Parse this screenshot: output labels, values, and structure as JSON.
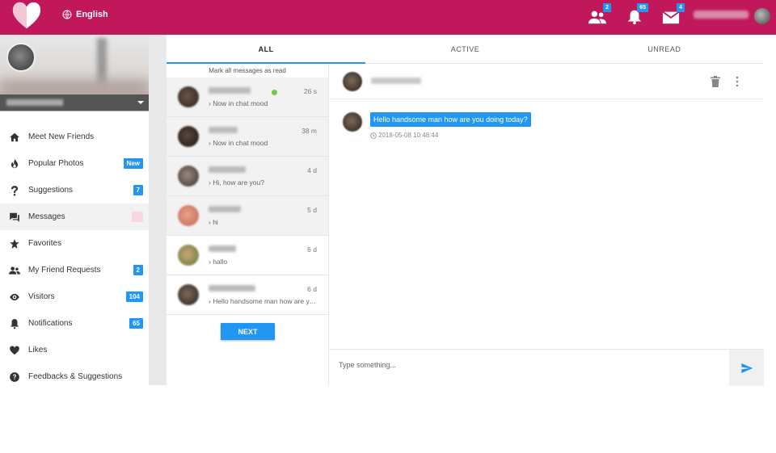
{
  "header": {
    "language": "English",
    "icons": [
      {
        "name": "friends-icon",
        "badge": "2"
      },
      {
        "name": "bell-icon",
        "badge": "65"
      },
      {
        "name": "mail-icon",
        "badge": "4"
      }
    ],
    "brand_color": "#c0185b"
  },
  "sidebar": {
    "items": [
      {
        "label": "Meet New Friends",
        "icon": "home-icon",
        "badge": ""
      },
      {
        "label": "Popular Photos",
        "icon": "flame-icon",
        "badge": "New"
      },
      {
        "label": "Suggestions",
        "icon": "question-icon",
        "badge": "7"
      },
      {
        "label": "Messages",
        "icon": "chat-icon",
        "badge": ""
      },
      {
        "label": "Favorites",
        "icon": "star-icon",
        "badge": ""
      },
      {
        "label": "My Friend Requests",
        "icon": "people-icon",
        "badge": "2"
      },
      {
        "label": "Visitors",
        "icon": "eye-icon",
        "badge": "104"
      },
      {
        "label": "Notifications",
        "icon": "bell-icon",
        "badge": "65"
      },
      {
        "label": "Likes",
        "icon": "heart-icon",
        "badge": ""
      },
      {
        "label": "Feedbacks & Suggestions",
        "icon": "help-circle-icon",
        "badge": ""
      }
    ]
  },
  "tabs": [
    {
      "label": "ALL",
      "active": true
    },
    {
      "label": "ACTIVE",
      "active": false
    },
    {
      "label": "UNREAD",
      "active": false
    }
  ],
  "conversations": {
    "mark_all_read": "Mark all messages as read",
    "items": [
      {
        "preview": "› Now in chat mood",
        "time": "26 s",
        "online": true
      },
      {
        "preview": "› Now in chat mood",
        "time": "38 m",
        "online": false
      },
      {
        "preview": "› Hi, how are you?",
        "time": "4 d",
        "online": false
      },
      {
        "preview": "› hi",
        "time": "5 d",
        "online": false
      },
      {
        "preview": "› hallo",
        "time": "6 d",
        "online": false
      },
      {
        "preview": "› Hello handsome man how are you doing today?",
        "time": "6 d",
        "online": false
      }
    ],
    "next_label": "NEXT"
  },
  "chat": {
    "messages": [
      {
        "text": "Hello handsome man how are you doing today?",
        "timestamp": "2018-05-08 10:48:44"
      }
    ],
    "composer_placeholder": "Type something..."
  }
}
